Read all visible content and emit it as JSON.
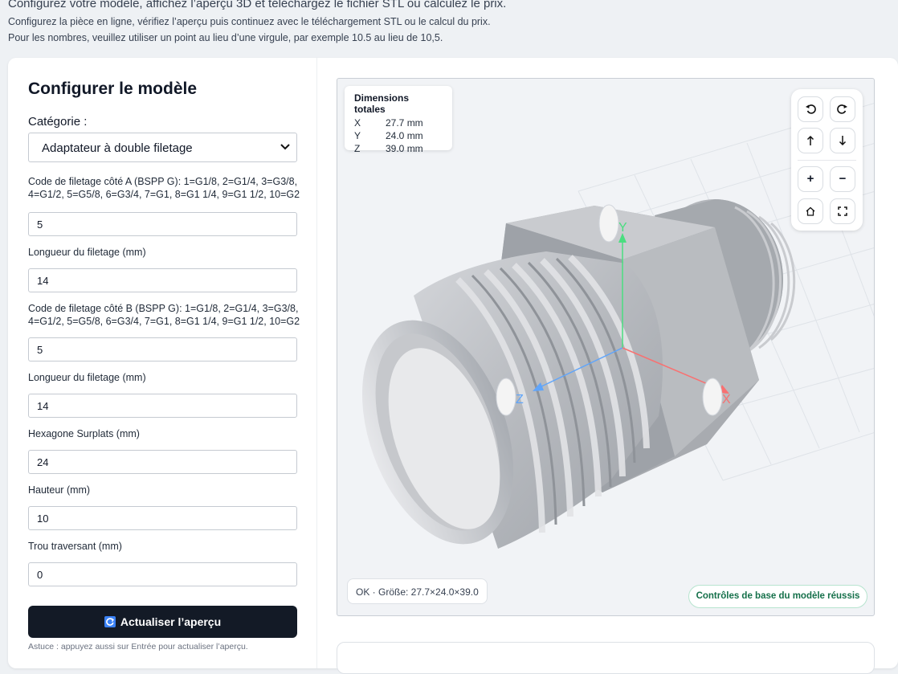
{
  "intro": {
    "line1": "Configurez votre modèle, affichez l’aperçu 3D et téléchargez le fichier STL ou calculez le prix.",
    "line2": "Configurez la pièce en ligne, vérifiez l’aperçu puis continuez avec le téléchargement STL ou le calcul du prix.",
    "line3": "Pour les nombres, veuillez utiliser un point au lieu d’une virgule, par exemple 10.5 au lieu de 10,5."
  },
  "config": {
    "title": "Configurer le modèle",
    "category_label": "Catégorie :",
    "category_value": "Adaptateur à double filetage",
    "fields": [
      {
        "label": "Code de filetage côté A (BSPP G): 1=G1/8, 2=G1/4, 3=G3/8, 4=G1/2, 5=G5/8, 6=G3/4, 7=G1, 8=G1 1/4, 9=G1 1/2, 10=G2",
        "value": "5"
      },
      {
        "label": "Longueur du filetage (mm)",
        "value": "14"
      },
      {
        "label": "Code de filetage côté B (BSPP G): 1=G1/8, 2=G1/4, 3=G3/8, 4=G1/2, 5=G5/8, 6=G3/4, 7=G1, 8=G1 1/4, 9=G1 1/2, 10=G2",
        "value": "5"
      },
      {
        "label": "Longueur du filetage (mm)",
        "value": "14"
      },
      {
        "label": "Hexagone Surplats (mm)",
        "value": "24"
      },
      {
        "label": "Hauteur (mm)",
        "value": "10"
      },
      {
        "label": "Trou traversant (mm)",
        "value": "0"
      }
    ],
    "update_button": "Actualiser l’aperçu",
    "hint": "Astuce : appuyez aussi sur Entrée pour actualiser l’aperçu."
  },
  "viewer": {
    "dims_title": "Dimensions totales",
    "dims": [
      {
        "axis": "X",
        "value": "27.7 mm"
      },
      {
        "axis": "Y",
        "value": "24.0 mm"
      },
      {
        "axis": "Z",
        "value": "39.0 mm"
      }
    ],
    "axis_labels": {
      "x": "X",
      "y": "Y",
      "z": "Z"
    },
    "controls": {
      "rotate_left_icon": "rotate-left-icon",
      "rotate_right_icon": "rotate-right-icon",
      "up_icon": "arrow-up-icon",
      "down_icon": "arrow-down-icon",
      "zoom_in": "+",
      "zoom_out": "−",
      "home_icon": "home-icon",
      "fullscreen_icon": "fullscreen-icon"
    },
    "status": "OK · Größe: 27.7×24.0×39.0",
    "badge": "Contrôles de base du modèle réussis"
  },
  "colors": {
    "axis_x": "#f87171",
    "axis_y": "#4ade80",
    "axis_z": "#60a5fa",
    "button_dark": "#131a26",
    "badge_green": "#15704a"
  }
}
